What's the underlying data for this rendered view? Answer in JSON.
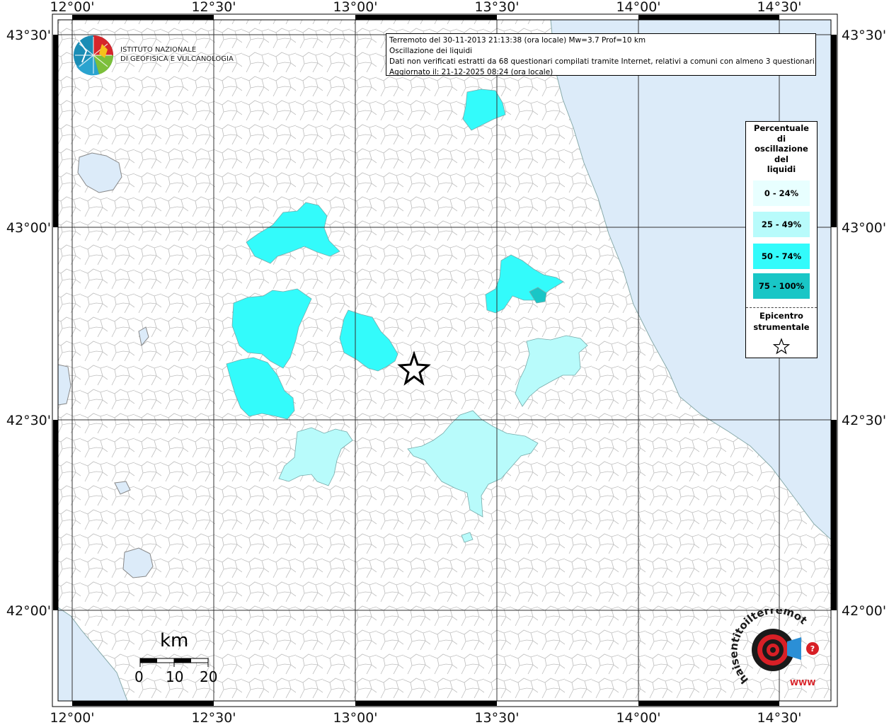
{
  "map": {
    "colors": {
      "sea": "#dcebf9",
      "land": "#ffffff",
      "border": "#9a9a9a",
      "grid": "#333333",
      "frame": "#000000",
      "class_0_24": "#e8ffff",
      "class_25_49": "#b8fbfb",
      "class_50_74": "#33fbfb",
      "class_75_100": "#19c6c6"
    },
    "longitude_ticks": [
      "12°00'",
      "12°30'",
      "13°00'",
      "13°30'",
      "14°00'",
      "14°30'"
    ],
    "latitude_ticks_left": [
      "43°30'",
      "43°00'",
      "42°30'",
      "42°00'"
    ],
    "latitude_ticks_right": [
      "43°30'",
      "43°00'",
      "42°30'",
      "42°00'"
    ]
  },
  "info": {
    "line1": "Terremoto del 30-11-2013 21:13:38 (ora locale) Mw=3.7 Prof=10 km",
    "line2": "Oscillazione dei liquidi",
    "line3": "Dati non verificati estratti da 68 questionari compilati tramite Internet, relativi a comuni con almeno 3 questionari.",
    "line4": "Aggiornato il: 21-12-2025 08:24 (ora locale)"
  },
  "legend": {
    "title_lines": [
      "Percentuale",
      "di",
      "oscillazione",
      "del",
      "liquidi"
    ],
    "classes": [
      {
        "label": "0 - 24%",
        "color": "#e8ffff"
      },
      {
        "label": "25 - 49%",
        "color": "#b8fbfb"
      },
      {
        "label": "50 - 74%",
        "color": "#33fbfb"
      },
      {
        "label": "75 - 100%",
        "color": "#19c6c6"
      }
    ],
    "epicenter_lines": [
      "Epicentro",
      "strumentale"
    ]
  },
  "logos": {
    "ingv_line1": "ISTITUTO NAZIONALE",
    "ingv_line2": "DI GEOFISICA E VULCANOLOGIA",
    "hst_text": "haisentitoilterremoto.it",
    "hst_url": "WWW"
  },
  "scale": {
    "unit": "km",
    "labels": [
      "0",
      "10",
      "20"
    ]
  }
}
